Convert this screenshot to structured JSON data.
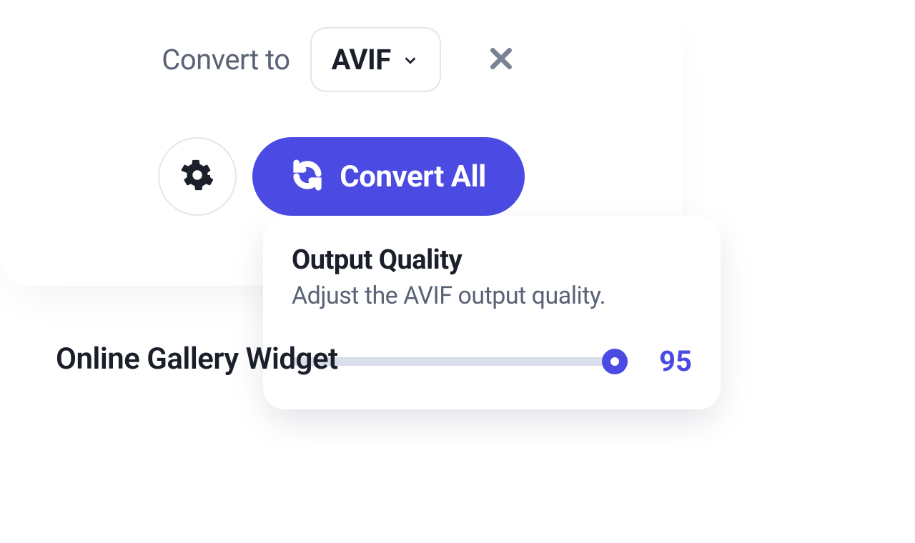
{
  "convert": {
    "label": "Convert to",
    "selected_format": "AVIF"
  },
  "actions": {
    "convert_all_label": "Convert All"
  },
  "quality_popover": {
    "title": "Output Quality",
    "description": "Adjust the AVIF output quality.",
    "value": 95,
    "min": 0,
    "max": 100
  },
  "footer": {
    "title": "Online Gallery Widget"
  },
  "colors": {
    "accent": "#4b4be3",
    "text_muted": "#5a6275",
    "track": "#d8deea"
  }
}
